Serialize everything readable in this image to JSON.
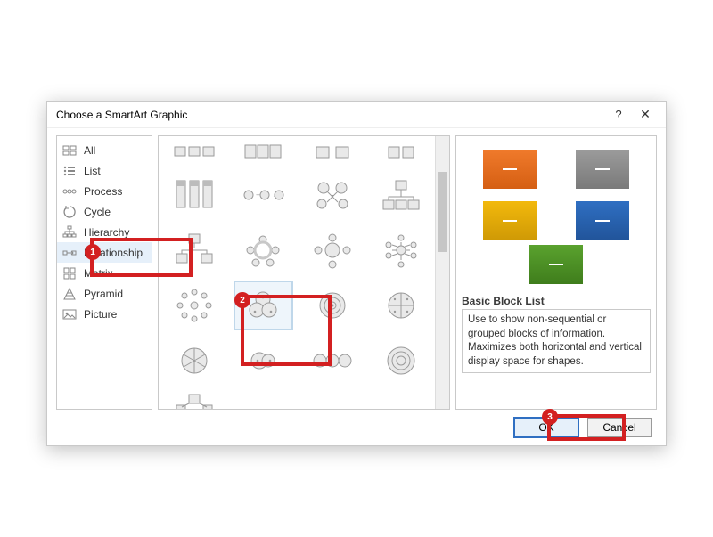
{
  "dialog": {
    "title": "Choose a SmartArt Graphic",
    "help_label": "?",
    "close_label": "✕"
  },
  "categories": {
    "items": [
      {
        "label": "All"
      },
      {
        "label": "List"
      },
      {
        "label": "Process"
      },
      {
        "label": "Cycle"
      },
      {
        "label": "Hierarchy"
      },
      {
        "label": "Relationship"
      },
      {
        "label": "Matrix"
      },
      {
        "label": "Pyramid"
      },
      {
        "label": "Picture"
      }
    ],
    "selected_index": 5
  },
  "gallery": {
    "selected_row": 3,
    "selected_col": 1
  },
  "preview": {
    "name": "Basic Block List",
    "description": "Use to show non-sequential or grouped blocks of information. Maximizes both horizontal and vertical display space for shapes.",
    "blocks": [
      "orange",
      "gray",
      "yellow",
      "blue",
      "green"
    ]
  },
  "buttons": {
    "ok": "OK",
    "cancel": "Cancel"
  },
  "callouts": {
    "one": "1",
    "two": "2",
    "three": "3"
  }
}
